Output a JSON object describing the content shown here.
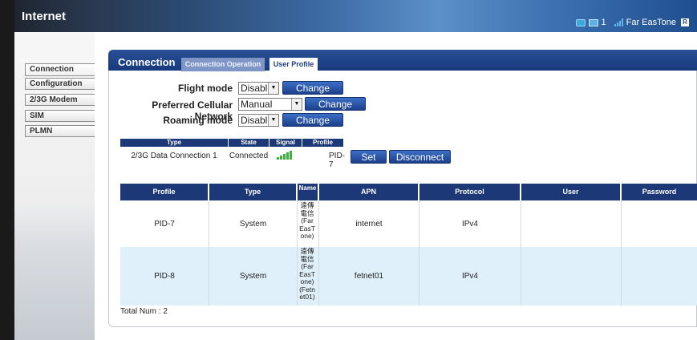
{
  "header": {
    "title": "Internet",
    "status": {
      "message_count": "1",
      "operator": "Far EasTone",
      "roaming_badge": "R"
    }
  },
  "sidebar": {
    "items": [
      {
        "label": "Connection"
      },
      {
        "label": "Configuration"
      },
      {
        "label": "2/3G Modem"
      },
      {
        "label": "SIM"
      },
      {
        "label": "PLMN"
      }
    ]
  },
  "panel": {
    "title": "Connection",
    "tabs": [
      {
        "label": "Connection Operation"
      },
      {
        "label": "User Profile"
      }
    ]
  },
  "settings": {
    "flight_mode": {
      "label": "Flight mode",
      "value": "Disable",
      "button": "Change"
    },
    "preferred_network": {
      "label": "Preferred Cellular Network",
      "value": "Manual",
      "button": "Change"
    },
    "roaming_mode": {
      "label": "Roaming mode",
      "value": "Disable",
      "button": "Change"
    }
  },
  "connection_table": {
    "headers": [
      "Type",
      "State",
      "Signal",
      "Profile"
    ],
    "row": {
      "type": "2/3G Data Connection 1",
      "state": "Connected",
      "signal_bars": 5,
      "profile": "PID-7",
      "set_button": "Set",
      "disconnect_button": "Disconnect"
    }
  },
  "profile_table": {
    "headers": [
      "Profile",
      "Type",
      "Name",
      "APN",
      "Protocol",
      "User",
      "Password"
    ],
    "rows": [
      {
        "profile": "PID-7",
        "type": "System",
        "name": "遠傳電信(Far EasTone)",
        "apn": "internet",
        "protocol": "IPv4",
        "user": "",
        "password": ""
      },
      {
        "profile": "PID-8",
        "type": "System",
        "name": "遠傳電信(Far EasTone)(Fetnet01)",
        "apn": "fetnet01",
        "protocol": "IPv4",
        "user": "",
        "password": ""
      }
    ],
    "total_label": "Total Num : 2"
  },
  "colors": {
    "header_blue": "#1c3876",
    "button_blue": "#2a57ad",
    "row_highlight": "#dff0fa",
    "signal_green": "#3cb43c"
  }
}
